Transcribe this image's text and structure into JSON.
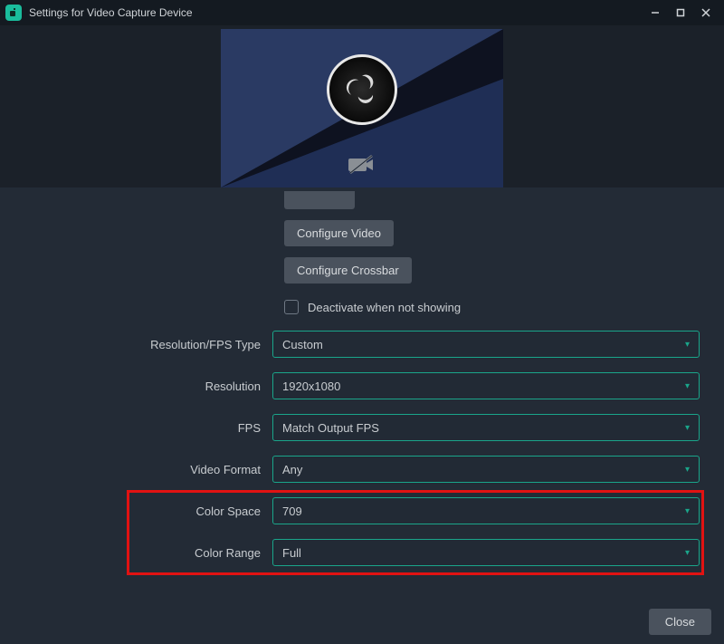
{
  "window": {
    "title": "Settings for Video Capture Device"
  },
  "buttons": {
    "configure_video": "Configure Video",
    "configure_crossbar": "Configure Crossbar",
    "close": "Close"
  },
  "checkbox": {
    "deactivate_label": "Deactivate when not showing",
    "deactivate_checked": false
  },
  "fields": {
    "resolution_fps_type": {
      "label": "Resolution/FPS Type",
      "value": "Custom"
    },
    "resolution": {
      "label": "Resolution",
      "value": "1920x1080"
    },
    "fps": {
      "label": "FPS",
      "value": "Match Output FPS"
    },
    "video_format": {
      "label": "Video Format",
      "value": "Any"
    },
    "color_space": {
      "label": "Color Space",
      "value": "709"
    },
    "color_range": {
      "label": "Color Range",
      "value": "Full"
    }
  },
  "icons": {
    "app": "streamlabs-icon",
    "preview_logo": "obs-logo",
    "camera_off": "camera-off-icon"
  }
}
